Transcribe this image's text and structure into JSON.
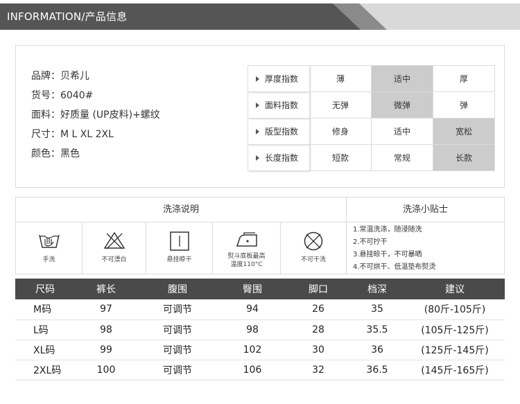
{
  "header": {
    "title": "INFORMATION/产品信息"
  },
  "info": {
    "lines": [
      "品牌：贝希儿",
      "货号：6040#",
      "面料：好质量 (UP皮料)+螺纹",
      "尺寸：M L XL 2XL",
      "颜色：黑色"
    ]
  },
  "indices": [
    {
      "label": "厚度指数",
      "options": [
        "薄",
        "适中",
        "厚"
      ],
      "selected": 1
    },
    {
      "label": "面料指数",
      "options": [
        "无弹",
        "微弹",
        "弹"
      ],
      "selected": 1
    },
    {
      "label": "版型指数",
      "options": [
        "修身",
        "适中",
        "宽松"
      ],
      "selected": 2
    },
    {
      "label": "长度指数",
      "options": [
        "短款",
        "常规",
        "长款"
      ],
      "selected": 2
    }
  ],
  "wash": {
    "title": "洗涤说明",
    "tips_title": "洗涤小贴士",
    "icons": [
      {
        "icon": "hand-wash-icon",
        "caption": "手洗"
      },
      {
        "icon": "no-bleach-icon",
        "caption": "不可漂白"
      },
      {
        "icon": "hang-dry-icon",
        "caption": "悬挂晾干"
      },
      {
        "icon": "iron-icon",
        "caption": "熨斗底板最高温度110°C"
      },
      {
        "icon": "no-dry-clean-icon",
        "caption": "不可干洗"
      }
    ],
    "iron_caption_lines": [
      "熨斗底板最高",
      "温度110°C"
    ],
    "tips": [
      "1.常温洗涤，随浸随洗",
      "2.不可拧干",
      "3.悬挂晾干，不可暴晒",
      "4.不可烘干、低温垫布熨烫"
    ]
  },
  "size_table": {
    "headers": [
      "尺码",
      "裤长",
      "腹围",
      "臀围",
      "脚口",
      "档深",
      "建议"
    ],
    "rows": [
      [
        "M码",
        "97",
        "可调节",
        "94",
        "26",
        "35",
        "(80斤-105斤)"
      ],
      [
        "L码",
        "98",
        "可调节",
        "98",
        "28",
        "35.5",
        "(105斤-125斤)"
      ],
      [
        "XL码",
        "99",
        "可调节",
        "102",
        "30",
        "36",
        "(125斤-145斤)"
      ],
      [
        "2XL码",
        "100",
        "可调节",
        "106",
        "32",
        "36.5",
        "(145斤-165斤)"
      ]
    ]
  },
  "colors": {
    "header_dark": "#555555",
    "header_light": "#d9d9d9",
    "selected": "#cccccc",
    "table_head": "#4a4a4a"
  }
}
